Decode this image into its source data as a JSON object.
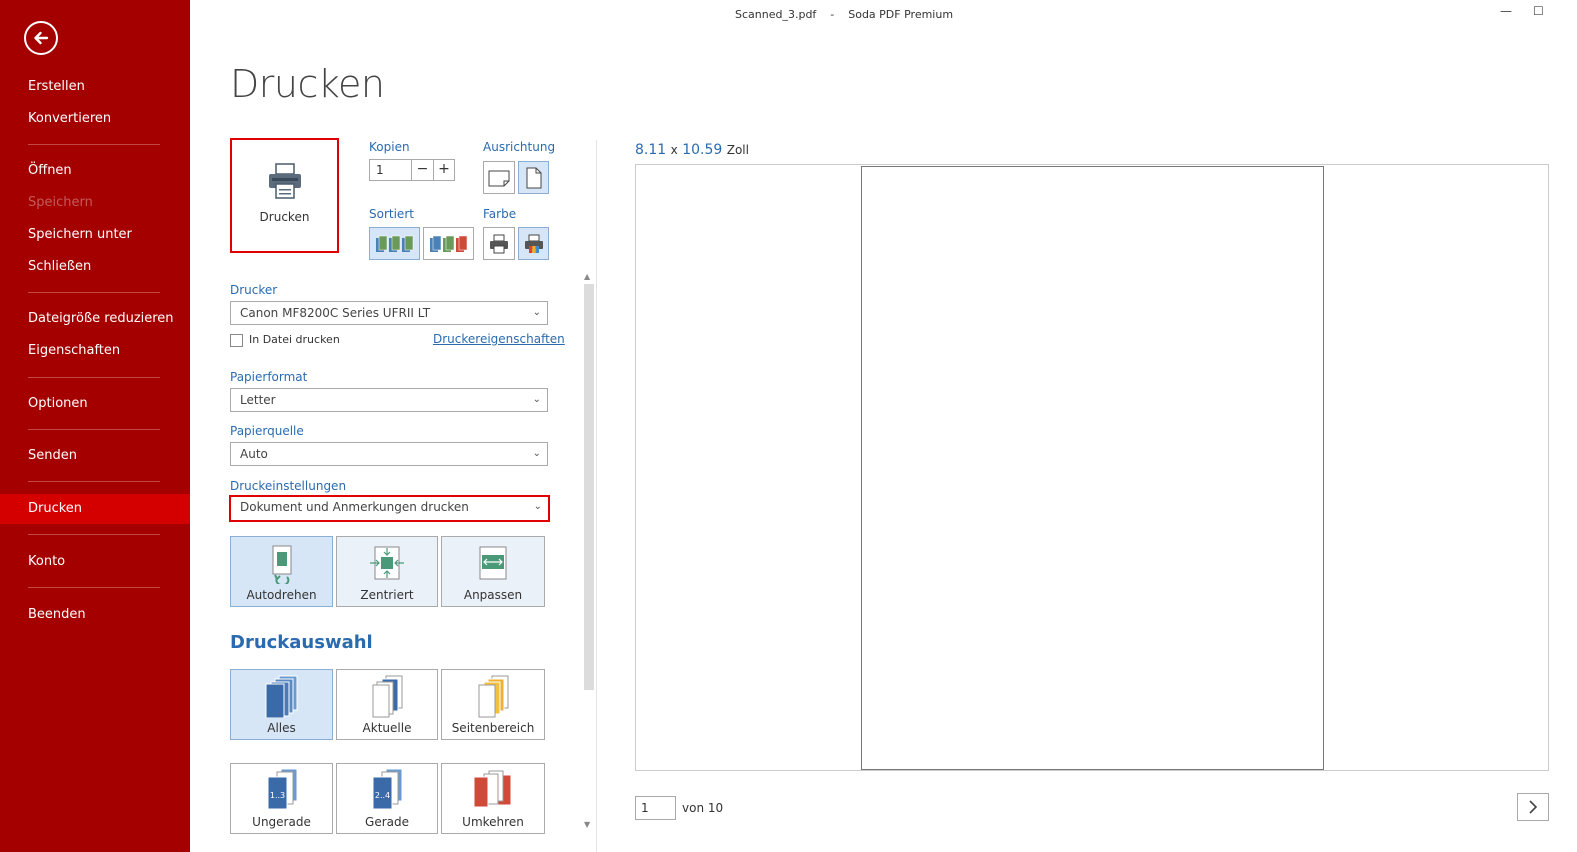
{
  "window": {
    "title": "Scanned_3.pdf    -    Soda PDF Premium",
    "minimize": "—",
    "maximize": "☐"
  },
  "sidebar": {
    "items": [
      {
        "label": "Erstellen"
      },
      {
        "label": "Konvertieren"
      },
      {
        "label": "Öffnen"
      },
      {
        "label": "Speichern"
      },
      {
        "label": "Speichern unter"
      },
      {
        "label": "Schließen"
      },
      {
        "label": "Dateigröße reduzieren"
      },
      {
        "label": "Eigenschaften"
      },
      {
        "label": "Optionen"
      },
      {
        "label": "Senden"
      },
      {
        "label": "Drucken"
      },
      {
        "label": "Konto"
      },
      {
        "label": "Beenden"
      }
    ]
  },
  "main": {
    "title": "Drucken",
    "print_button": "Drucken",
    "copies_label": "Kopien",
    "copies_value": "1",
    "orientation_label": "Ausrichtung",
    "sorted_label": "Sortiert",
    "color_label": "Farbe",
    "printer_label": "Drucker",
    "printer_value": "Canon MF8200C Series UFRII LT",
    "print_to_file": "In Datei drucken",
    "printer_properties": "Druckereigenschaften",
    "paper_format_label": "Papierformat",
    "paper_format_value": "Letter",
    "paper_source_label": "Papierquelle",
    "paper_source_value": "Auto",
    "print_settings_label": "Druckeinstellungen",
    "print_settings_value": "Dokument und Anmerkungen drucken",
    "layout_buttons": [
      "Autodrehen",
      "Zentriert",
      "Anpassen"
    ],
    "selection_title": "Druckauswahl",
    "selection_buttons": [
      "Alles",
      "Aktuelle",
      "Seitenbereich",
      "Ungerade",
      "Gerade",
      "Umkehren"
    ],
    "odd_icon_text": "1..3",
    "even_icon_text": "2..4"
  },
  "preview": {
    "width": "8.11",
    "x": "x",
    "height": "10.59",
    "unit": "Zoll",
    "page_value": "1",
    "of_label": "von 10"
  },
  "colors": {
    "sidebar": "#a40000",
    "sidebar_active": "#d40000",
    "accent_blue": "#2a6bb0",
    "highlight_red": "#e00000"
  }
}
